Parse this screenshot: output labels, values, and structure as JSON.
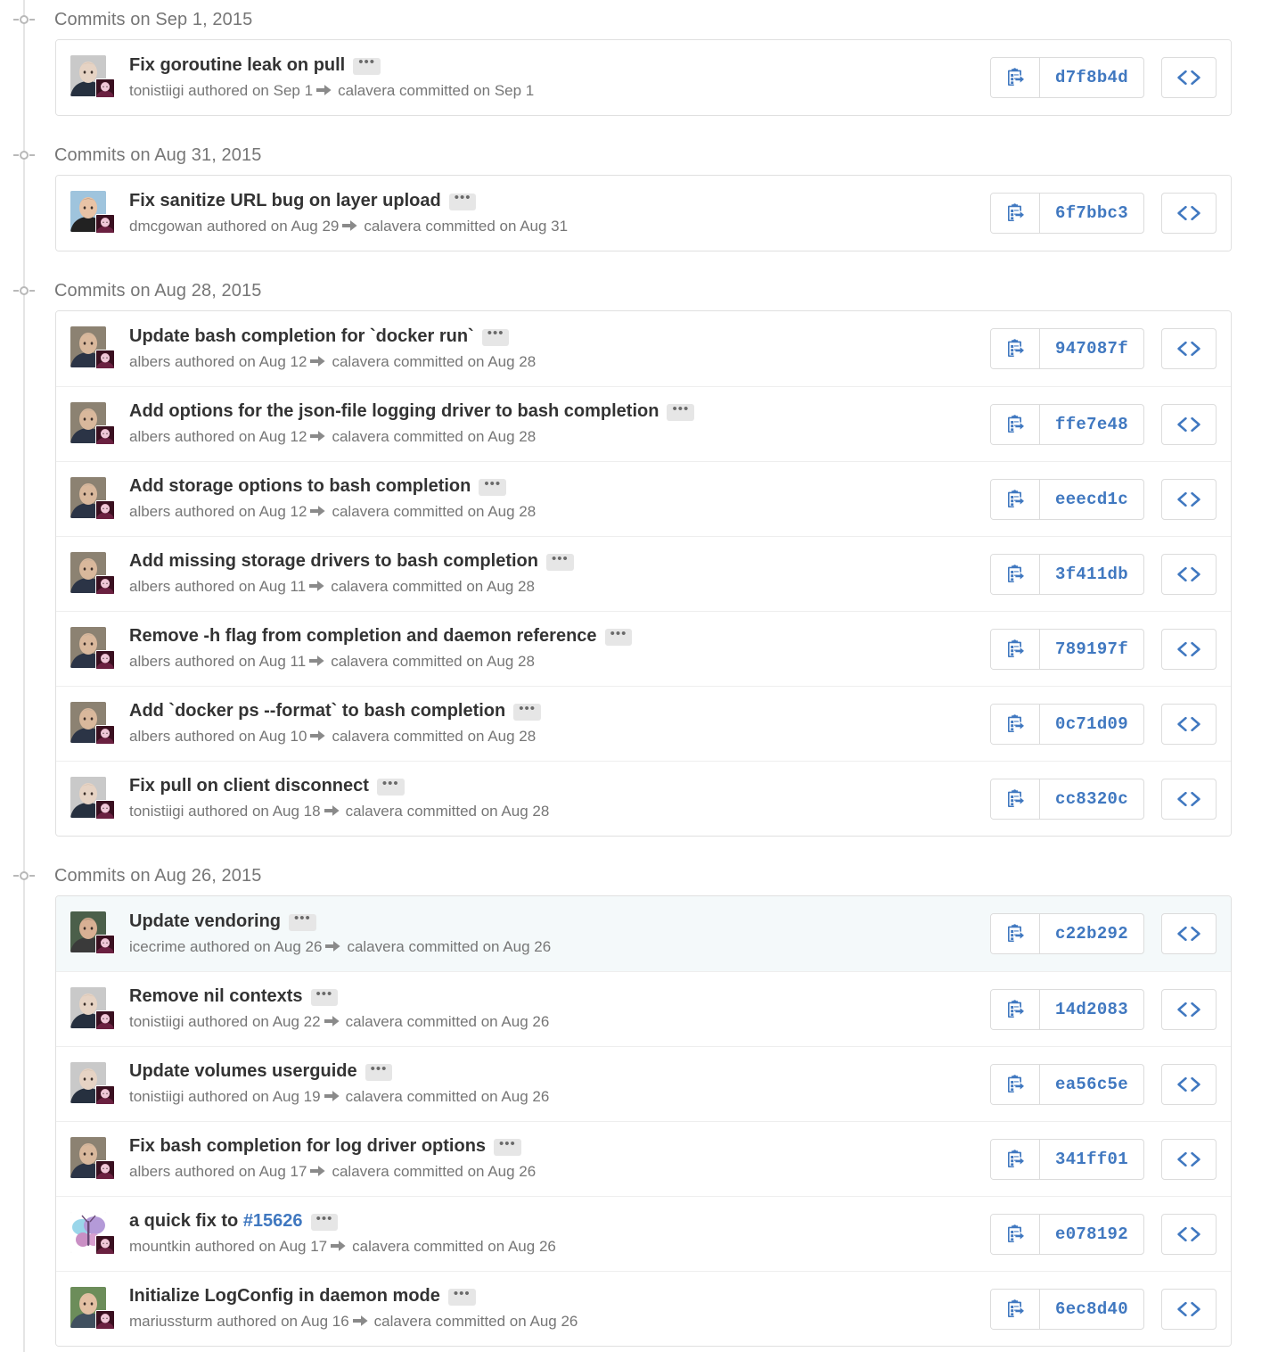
{
  "page": {
    "title": "Commits",
    "accent_color": "#4078c0",
    "text_color": "#333333",
    "muted_color": "#767676",
    "highlight_row_color": "#f4f9fa"
  },
  "icons": {
    "copy": "clipboard-copy-icon",
    "code": "code-brackets-icon",
    "ellipsis": "ellipsis-icon",
    "arrow": "arrow-right-icon",
    "marker": "timeline-marker-icon"
  },
  "labels": {
    "ellipsis": "•••",
    "authored": "authored on",
    "committed": "committed on"
  },
  "groups": [
    {
      "header": "Commits on Sep 1, 2015",
      "commits": [
        {
          "title": "Fix goroutine leak on pull",
          "title_prefix": "",
          "issue": "",
          "author": "tonistiigi",
          "authored_on": "Sep 1",
          "committer": "calavera",
          "committed_on": "Sep 1",
          "sha": "d7f8b4d",
          "highlighted": false,
          "avatar": "tonistiigi"
        }
      ]
    },
    {
      "header": "Commits on Aug 31, 2015",
      "commits": [
        {
          "title": "Fix sanitize URL bug on layer upload",
          "title_prefix": "",
          "issue": "",
          "author": "dmcgowan",
          "authored_on": "Aug 29",
          "committer": "calavera",
          "committed_on": "Aug 31",
          "sha": "6f7bbc3",
          "highlighted": false,
          "avatar": "dmcgowan"
        }
      ]
    },
    {
      "header": "Commits on Aug 28, 2015",
      "commits": [
        {
          "title": "Update bash completion for `docker run`",
          "title_prefix": "",
          "issue": "",
          "author": "albers",
          "authored_on": "Aug 12",
          "committer": "calavera",
          "committed_on": "Aug 28",
          "sha": "947087f",
          "highlighted": false,
          "avatar": "albers"
        },
        {
          "title": "Add options for the json-file logging driver to bash completion",
          "title_prefix": "",
          "issue": "",
          "author": "albers",
          "authored_on": "Aug 12",
          "committer": "calavera",
          "committed_on": "Aug 28",
          "sha": "ffe7e48",
          "highlighted": false,
          "avatar": "albers"
        },
        {
          "title": "Add storage options to bash completion",
          "title_prefix": "",
          "issue": "",
          "author": "albers",
          "authored_on": "Aug 12",
          "committer": "calavera",
          "committed_on": "Aug 28",
          "sha": "eeecd1c",
          "highlighted": false,
          "avatar": "albers"
        },
        {
          "title": "Add missing storage drivers to bash completion",
          "title_prefix": "",
          "issue": "",
          "author": "albers",
          "authored_on": "Aug 11",
          "committer": "calavera",
          "committed_on": "Aug 28",
          "sha": "3f411db",
          "highlighted": false,
          "avatar": "albers"
        },
        {
          "title": "Remove -h flag from completion and daemon reference",
          "title_prefix": "",
          "issue": "",
          "author": "albers",
          "authored_on": "Aug 11",
          "committer": "calavera",
          "committed_on": "Aug 28",
          "sha": "789197f",
          "highlighted": false,
          "avatar": "albers"
        },
        {
          "title": "Add `docker ps --format` to bash completion",
          "title_prefix": "",
          "issue": "",
          "author": "albers",
          "authored_on": "Aug 10",
          "committer": "calavera",
          "committed_on": "Aug 28",
          "sha": "0c71d09",
          "highlighted": false,
          "avatar": "albers"
        },
        {
          "title": "Fix pull on client disconnect",
          "title_prefix": "",
          "issue": "",
          "author": "tonistiigi",
          "authored_on": "Aug 18",
          "committer": "calavera",
          "committed_on": "Aug 28",
          "sha": "cc8320c",
          "highlighted": false,
          "avatar": "tonistiigi"
        }
      ]
    },
    {
      "header": "Commits on Aug 26, 2015",
      "commits": [
        {
          "title": "Update vendoring",
          "title_prefix": "",
          "issue": "",
          "author": "icecrime",
          "authored_on": "Aug 26",
          "committer": "calavera",
          "committed_on": "Aug 26",
          "sha": "c22b292",
          "highlighted": true,
          "avatar": "icecrime"
        },
        {
          "title": "Remove nil contexts",
          "title_prefix": "",
          "issue": "",
          "author": "tonistiigi",
          "authored_on": "Aug 22",
          "committer": "calavera",
          "committed_on": "Aug 26",
          "sha": "14d2083",
          "highlighted": false,
          "avatar": "tonistiigi"
        },
        {
          "title": "Update volumes userguide",
          "title_prefix": "",
          "issue": "",
          "author": "tonistiigi",
          "authored_on": "Aug 19",
          "committer": "calavera",
          "committed_on": "Aug 26",
          "sha": "ea56c5e",
          "highlighted": false,
          "avatar": "tonistiigi"
        },
        {
          "title": "Fix bash completion for log driver options",
          "title_prefix": "",
          "issue": "",
          "author": "albers",
          "authored_on": "Aug 17",
          "committer": "calavera",
          "committed_on": "Aug 26",
          "sha": "341ff01",
          "highlighted": false,
          "avatar": "albers"
        },
        {
          "title": "a quick fix to #15626",
          "title_prefix": "a quick fix to ",
          "issue": "#15626",
          "author": "mountkin",
          "authored_on": "Aug 17",
          "committer": "calavera",
          "committed_on": "Aug 26",
          "sha": "e078192",
          "highlighted": false,
          "avatar": "mountkin"
        },
        {
          "title": "Initialize LogConfig in daemon mode",
          "title_prefix": "",
          "issue": "",
          "author": "mariussturm",
          "authored_on": "Aug 16",
          "committer": "calavera",
          "committed_on": "Aug 26",
          "sha": "6ec8d40",
          "highlighted": false,
          "avatar": "mariussturm"
        }
      ]
    }
  ]
}
